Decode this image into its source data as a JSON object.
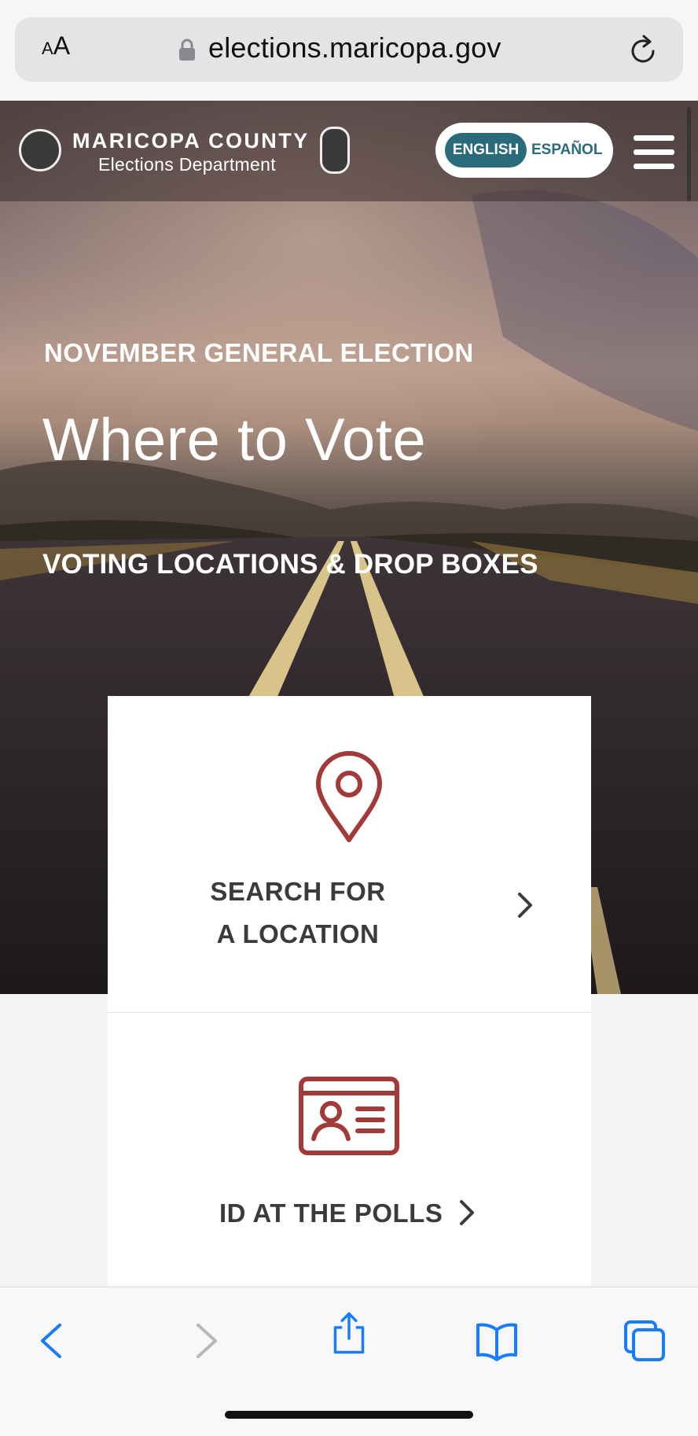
{
  "browser": {
    "text_size_label": "AA",
    "url": "elections.maricopa.gov"
  },
  "header": {
    "brand_title": "MARICOPA COUNTY",
    "brand_subtitle": "Elections Department",
    "lang_english": "ENGLISH",
    "lang_spanish": "ESPAÑOL"
  },
  "hero": {
    "eyebrow": "NOVEMBER GENERAL ELECTION",
    "title": "Where to Vote",
    "subtitle": "VOTING LOCATIONS & DROP BOXES"
  },
  "cards": {
    "search_label": "SEARCH FOR A LOCATION",
    "id_label": "ID AT THE POLLS"
  },
  "colors": {
    "accent_teal": "#2a6b7b",
    "icon_red": "#a33a3a",
    "ios_blue": "#1a7cf6"
  },
  "icons": {
    "lock": "lock-icon",
    "reload": "reload-icon",
    "menu": "hamburger-menu-icon",
    "pin": "map-pin-icon",
    "id_card": "id-card-icon",
    "chevron": "chevron-right-icon",
    "back": "back-arrow-icon",
    "forward": "forward-arrow-icon",
    "share": "share-icon",
    "bookmarks": "bookmarks-icon",
    "tabs": "tabs-icon"
  }
}
